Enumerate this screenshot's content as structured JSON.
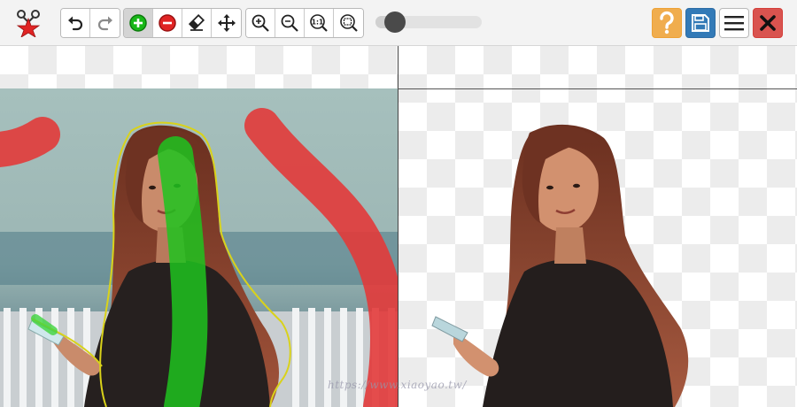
{
  "toolbar": {
    "logo_icon": "scissors-star-icon",
    "history": [
      "undo-icon",
      "redo-icon"
    ],
    "edit_tools": [
      "mark-keep-icon",
      "mark-remove-icon",
      "eraser-icon",
      "move-icon"
    ],
    "active_tool": "mark-keep",
    "zoom_tools": [
      "zoom-in-icon",
      "zoom-out-icon",
      "actual-size-icon",
      "zoom-fit-icon"
    ],
    "actual_size_label": "1:1",
    "brush_size_fraction": 0.08,
    "right_buttons": [
      "help-icon",
      "save-icon",
      "menu-icon",
      "close-icon"
    ]
  },
  "colors": {
    "help": "#f0ad4e",
    "save": "#337ab7",
    "close": "#d9534f",
    "keep_stroke": "#1ec31e",
    "remove_stroke": "#e23a3a",
    "outline": "#d9d21a"
  },
  "watermark": "https://www.xiaoyao.tw/"
}
